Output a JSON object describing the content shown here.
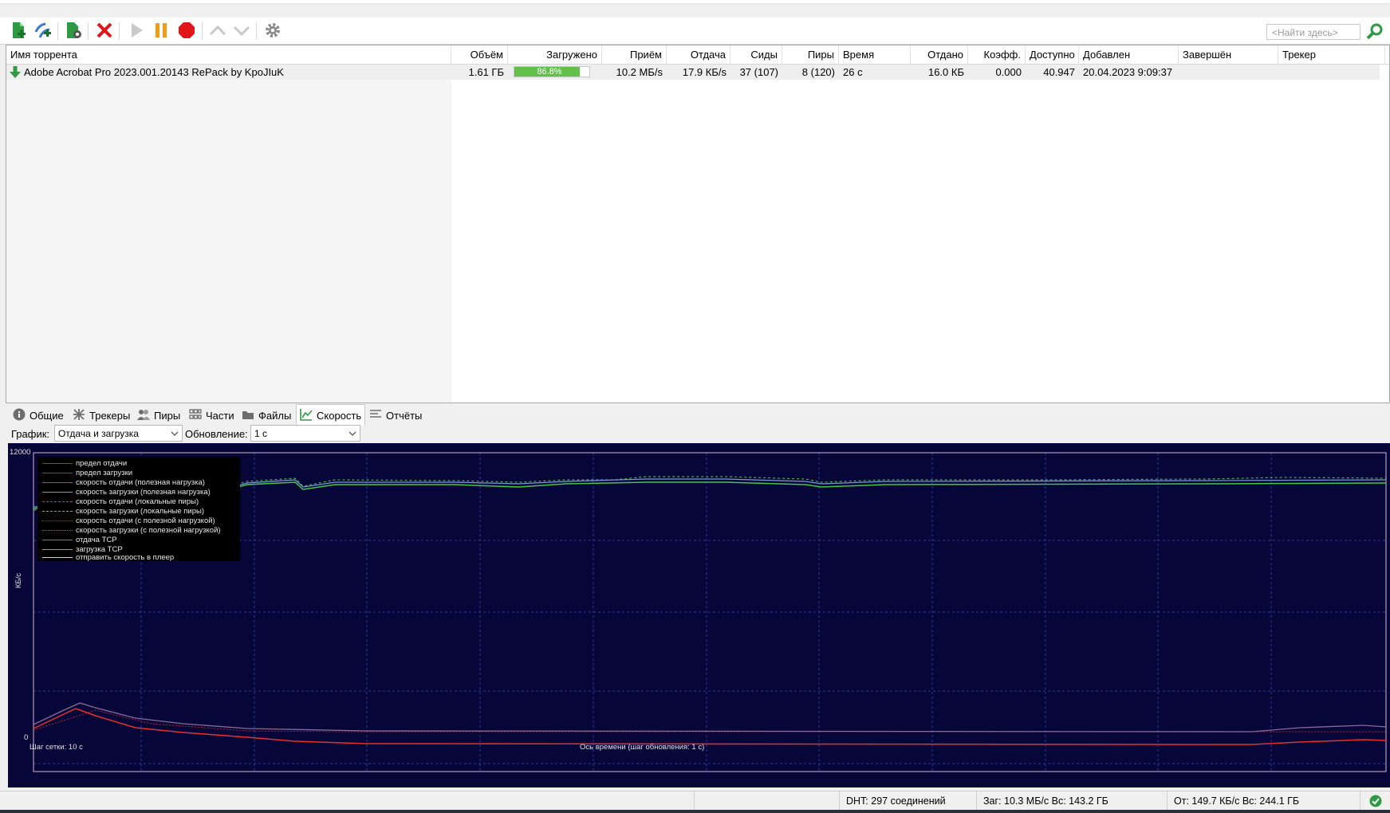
{
  "toolbar": {
    "search_placeholder": "<Найти здесь>"
  },
  "list": {
    "columns": [
      {
        "key": "name",
        "label": "Имя торрента"
      },
      {
        "key": "size",
        "label": "Объём"
      },
      {
        "key": "done",
        "label": "Загружено"
      },
      {
        "key": "down",
        "label": "Приём"
      },
      {
        "key": "up",
        "label": "Отдача"
      },
      {
        "key": "seeds",
        "label": "Сиды"
      },
      {
        "key": "peers",
        "label": "Пиры"
      },
      {
        "key": "time",
        "label": "Время"
      },
      {
        "key": "uploaded",
        "label": "Отдано"
      },
      {
        "key": "ratio",
        "label": "Коэфф."
      },
      {
        "key": "avail",
        "label": "Доступно"
      },
      {
        "key": "added",
        "label": "Добавлен"
      },
      {
        "key": "completed",
        "label": "Завершён"
      },
      {
        "key": "tracker",
        "label": "Трекер"
      }
    ],
    "rows": [
      {
        "name": "Adobe Acrobat Pro 2023.001.20143 RePack by KpoJIuK",
        "size": "1.61 ГБ",
        "done": "86.8%",
        "done_fraction": 0.868,
        "down": "10.2 МБ/s",
        "up": "17.9 КБ/s",
        "seeds": "37 (107)",
        "peers": "8 (120)",
        "time": "26 с",
        "uploaded": "16.0 КБ",
        "ratio": "0.000",
        "avail": "40.947",
        "added": "20.04.2023 9:09:37",
        "completed": "",
        "tracker": ""
      }
    ]
  },
  "tabs": [
    {
      "label": "Общие",
      "icon": "info-icon"
    },
    {
      "label": "Трекеры",
      "icon": "trackers-icon"
    },
    {
      "label": "Пиры",
      "icon": "peers-icon"
    },
    {
      "label": "Части",
      "icon": "pieces-icon"
    },
    {
      "label": "Файлы",
      "icon": "files-icon"
    },
    {
      "label": "Скорость",
      "icon": "speed-chart-icon",
      "active": true
    },
    {
      "label": "Отчёты",
      "icon": "logger-icon"
    }
  ],
  "controls": {
    "graph_label": "График:",
    "graph_value": "Отдача и загрузка",
    "update_label": "Обновление:",
    "update_value": "1 с"
  },
  "graph": {
    "ylabel": "КБ/с",
    "y_top": "12000",
    "y_bottom": "0",
    "grid_note": "Шаг сетки: 10 с",
    "x_note": "Ось времени (шаг обновления: 1 с)",
    "legend": [
      {
        "label": "предел отдачи",
        "color": "#c0202a",
        "style": "solid"
      },
      {
        "label": "предел загрузки",
        "color": "#1f7a2a",
        "style": "solid"
      },
      {
        "label": "скорость отдачи (полезная нагрузка)",
        "color": "#e8302e",
        "style": "solid"
      },
      {
        "label": "скорость загрузки (полезная нагрузка)",
        "color": "#42c842",
        "style": "solid"
      },
      {
        "label": "скорость отдачи (локальные пиры)",
        "color": "#e8302e",
        "style": "dashed"
      },
      {
        "label": "скорость загрузки (локальные пиры)",
        "color": "#42c842",
        "style": "dashed"
      },
      {
        "label": "скорость отдачи (с полезной нагрузкой)",
        "color": "#b02630",
        "style": "dotted"
      },
      {
        "label": "скорость загрузки (с полезной нагрузкой)",
        "color": "#2ea03a",
        "style": "dotted"
      },
      {
        "label": "отдача TCP",
        "color": "#8a6a9a",
        "style": "solid"
      },
      {
        "label": "загрузка TCP",
        "color": "#7a9ad8",
        "style": "solid"
      },
      {
        "label": "отправить скорость в плеер",
        "color": "#e6e63a",
        "style": "solid"
      }
    ],
    "colors": {
      "background": "#070638",
      "grid": "#2a3a9a",
      "download": "#42c842",
      "download_dash": "#5ad85a",
      "tcp_down": "#7a9ad8",
      "upload": "#e8302e",
      "tcp_up": "#8a6a9a"
    }
  },
  "status": {
    "dht": "DHT: 297 соединений",
    "download": "Заг: 10.3 МБ/с Вс: 143.2 ГБ",
    "upload": "От: 149.7 КБ/с Вс: 244.1 ГБ"
  }
}
